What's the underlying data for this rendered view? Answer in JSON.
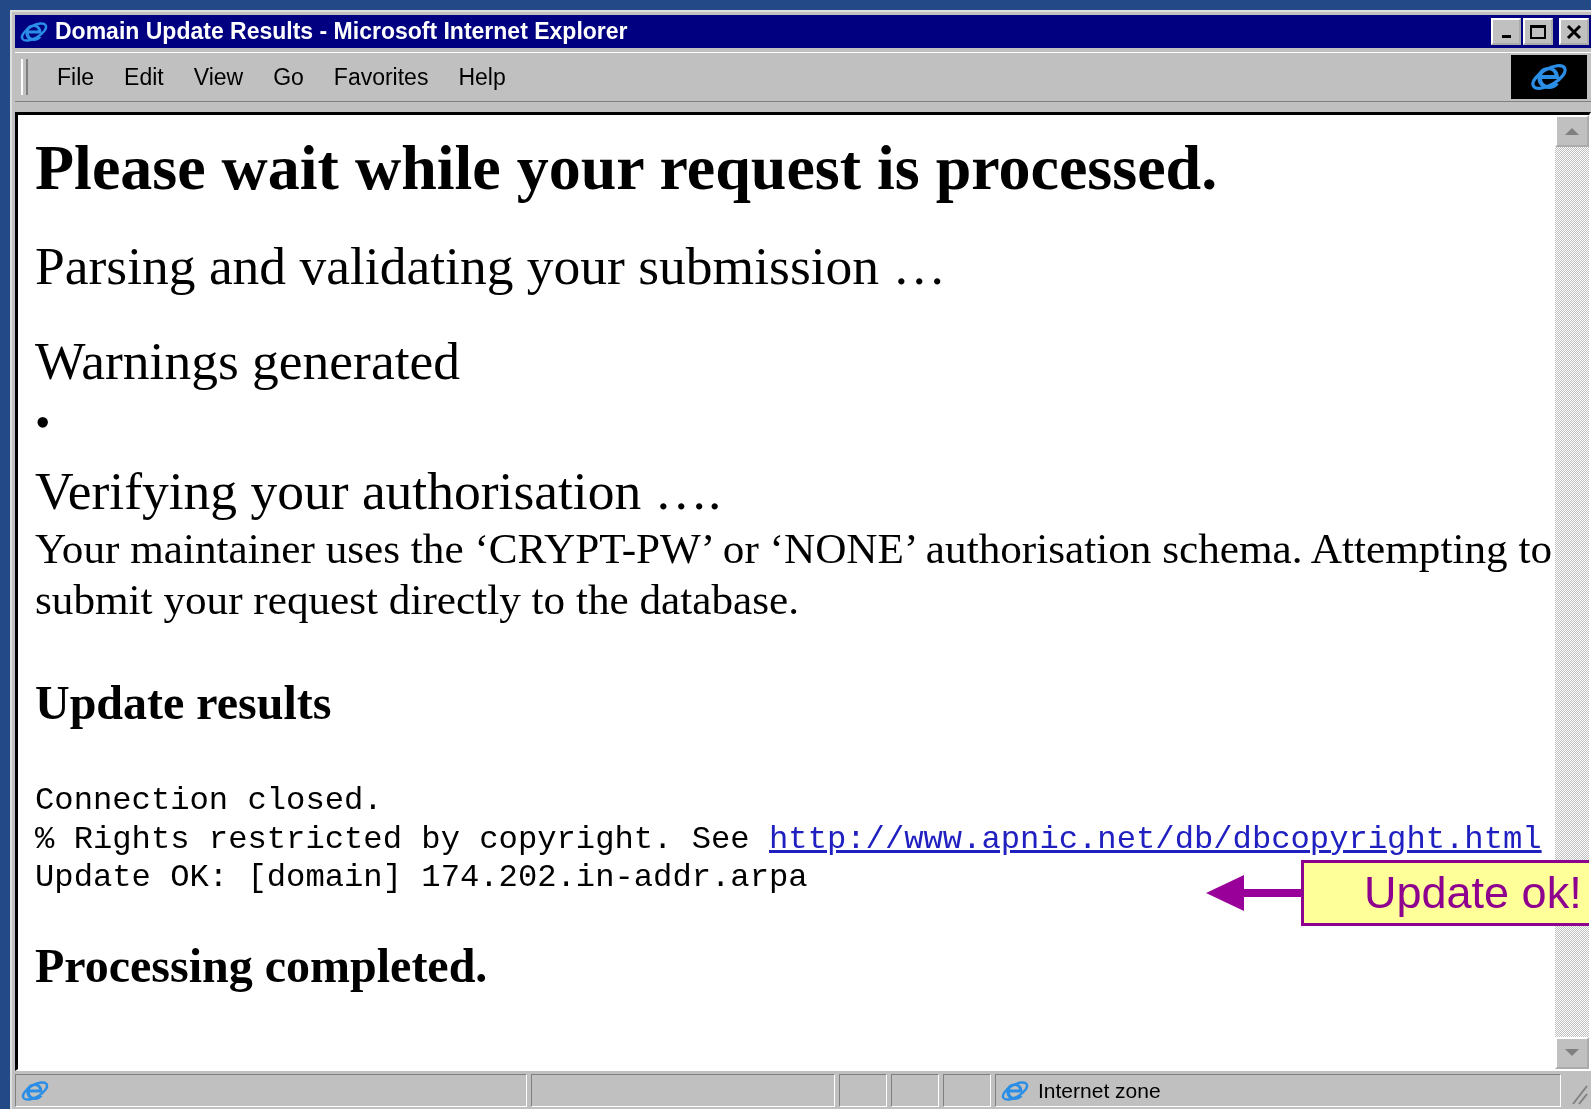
{
  "window": {
    "title": "Domain Update Results - Microsoft Internet Explorer"
  },
  "menu": [
    {
      "label": "File"
    },
    {
      "label": "Edit"
    },
    {
      "label": "View"
    },
    {
      "label": "Go"
    },
    {
      "label": "Favorites"
    },
    {
      "label": "Help"
    }
  ],
  "page": [
    {
      "kind": "title",
      "text": "Please wait while your request is processed."
    },
    {
      "kind": "step",
      "text": "Parsing and validating your submission …"
    },
    {
      "kind": "step",
      "text": "Warnings generated"
    },
    {
      "kind": "bullet",
      "text": "•"
    },
    {
      "kind": "step",
      "text": "Verifying your authorisation …."
    },
    {
      "kind": "paragraph",
      "text": "Your maintainer uses the ‘CRYPT-PW’ or ‘NONE’ authorisation schema. Attempting to submit your request directly to the database."
    },
    {
      "kind": "subheading",
      "text": "Update results"
    },
    {
      "kind": "mono",
      "lines": [
        {
          "text": "Connection closed."
        },
        {
          "text": "% Rights restricted by copyright. See ",
          "link": "http://www.apnic.net/db/dbcopyright.html"
        },
        {
          "text": "Update OK: [domain] 174.202.in-addr.arpa"
        }
      ]
    },
    {
      "kind": "subheading",
      "text": "Processing completed."
    }
  ],
  "callout": {
    "text": "Update ok!"
  },
  "status_bar": {
    "zone": "Internet zone"
  }
}
